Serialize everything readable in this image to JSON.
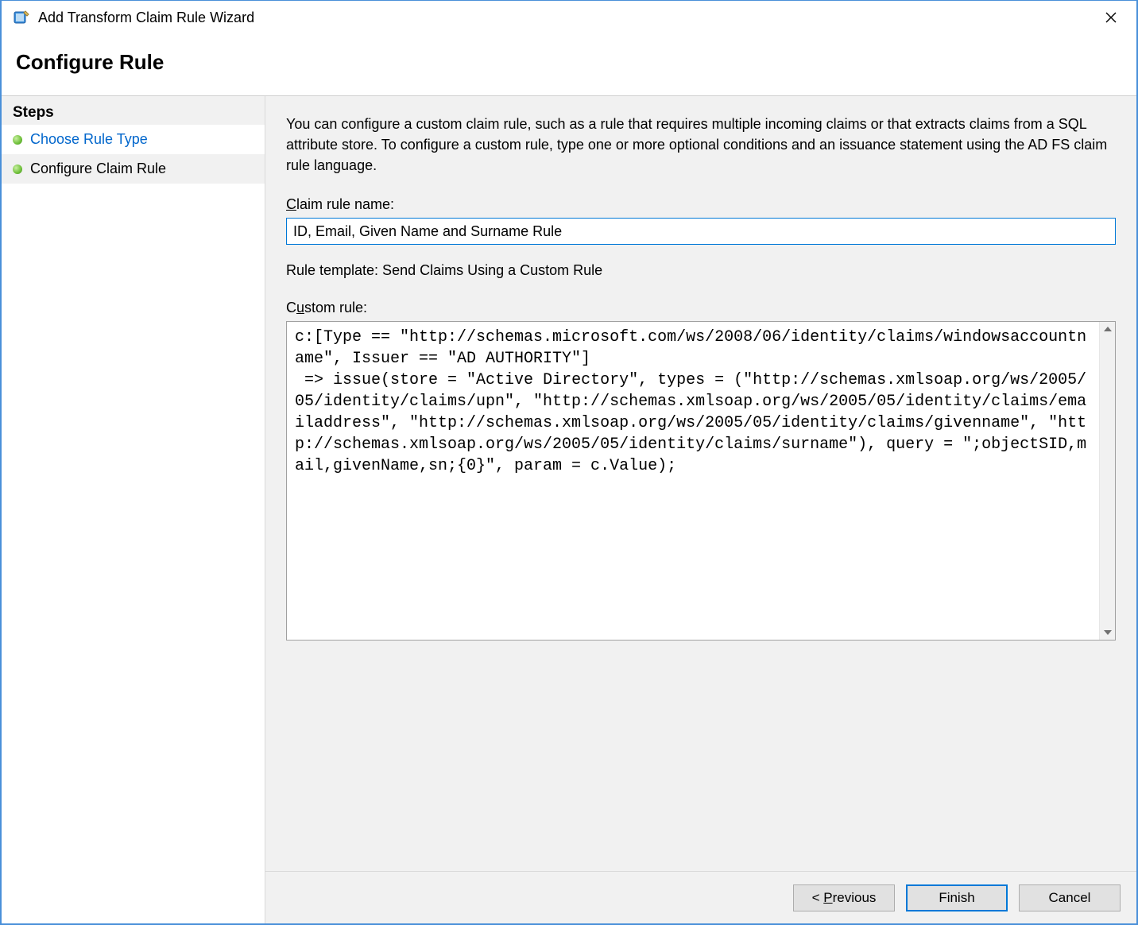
{
  "window": {
    "title": "Add Transform Claim Rule Wizard"
  },
  "header": {
    "title": "Configure Rule"
  },
  "sidebar": {
    "steps_label": "Steps",
    "items": [
      {
        "label": "Choose Rule Type"
      },
      {
        "label": "Configure Claim Rule"
      }
    ]
  },
  "main": {
    "intro": "You can configure a custom claim rule, such as a rule that requires multiple incoming claims or that extracts claims from a SQL attribute store. To configure a custom rule, type one or more optional conditions and an issuance statement using the AD FS claim rule language.",
    "claim_rule_name_label_pre": "C",
    "claim_rule_name_label_post": "laim rule name:",
    "claim_rule_name_value": "ID, Email, Given Name and Surname Rule",
    "rule_template_label": "Rule template: Send Claims Using a Custom Rule",
    "custom_rule_label_pre": "C",
    "custom_rule_label_post": "ustom rule:",
    "custom_rule_value": "c:[Type == \"http://schemas.microsoft.com/ws/2008/06/identity/claims/windowsaccountname\", Issuer == \"AD AUTHORITY\"]\n => issue(store = \"Active Directory\", types = (\"http://schemas.xmlsoap.org/ws/2005/05/identity/claims/upn\", \"http://schemas.xmlsoap.org/ws/2005/05/identity/claims/emailaddress\", \"http://schemas.xmlsoap.org/ws/2005/05/identity/claims/givenname\", \"http://schemas.xmlsoap.org/ws/2005/05/identity/claims/surname\"), query = \";objectSID,mail,givenName,sn;{0}\", param = c.Value);"
  },
  "footer": {
    "previous_pre": "< ",
    "previous_hot": "P",
    "previous_post": "revious",
    "finish": "Finish",
    "cancel": "Cancel"
  }
}
